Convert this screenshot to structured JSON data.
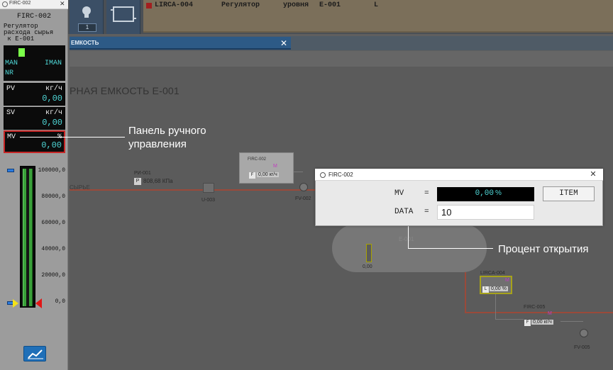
{
  "topbar": {
    "badge": "1",
    "alarm": {
      "tag": "LIRCA-004",
      "desc1": "Регулятор",
      "desc2": "уровня",
      "unit": "E-001",
      "level": "L"
    }
  },
  "tab": {
    "label": "ЕМКОСТЬ"
  },
  "scheme": {
    "title": "РНАЯ ЕМКОСТЬ Е-001",
    "syrie": "СЫРЬЕ",
    "pi_tag": "PИ-001",
    "pi_letter": "P",
    "pi_value": "808,68 КПа",
    "u003": "U-003",
    "fv002": "FV-002",
    "firc002_tag": "FIRC-002",
    "firc002_letter": "F",
    "firc002_value": "0,00 кг/ч",
    "firc002_m": "M",
    "tank_name": "E-001",
    "tank_value": "0,00",
    "lirca004_tag": "LIRCA-004",
    "lirca004_letter": "L",
    "lirca004_value": "0,00 %",
    "lirca004_m": "M",
    "firc005_tag": "FIRC-005",
    "firc005_letter": "F",
    "firc005_value": "0,00 кг/ч",
    "firc005_m": "M",
    "fv005": "FV-005"
  },
  "faceplate": {
    "window_title": "FIRC-002",
    "tag": "FIRC-002",
    "description": "Регулятор\nрасхода сырья\n к Е-001",
    "mode_left": "MAN",
    "mode_right": "IMAN",
    "mode_status": "NR",
    "pv": {
      "label": "PV",
      "unit": "кг/ч",
      "value": "0,00"
    },
    "sv": {
      "label": "SV",
      "unit": "кг/ч",
      "value": "0,00"
    },
    "mv": {
      "label": "MV",
      "unit": "%",
      "value": "0,00"
    },
    "scale": [
      "100000,0",
      "80000,0",
      "60000,0",
      "40000,0",
      "20000,0",
      "0,0"
    ]
  },
  "annotations": {
    "manual_panel": "Панель ручного\nуправления",
    "open_percent": "Процент открытия"
  },
  "dialog": {
    "title": "FIRC-002",
    "mv_label": "MV",
    "eq1": "=",
    "mv_value": "0,00",
    "mv_unit": "%",
    "data_label": "DATA",
    "eq2": "=",
    "data_value": "10",
    "item_button": "ITEM"
  },
  "colors": {
    "cyan_value": "#4fd7d7",
    "mv_border": "#c62626",
    "bar_green": "#3aa03a"
  }
}
